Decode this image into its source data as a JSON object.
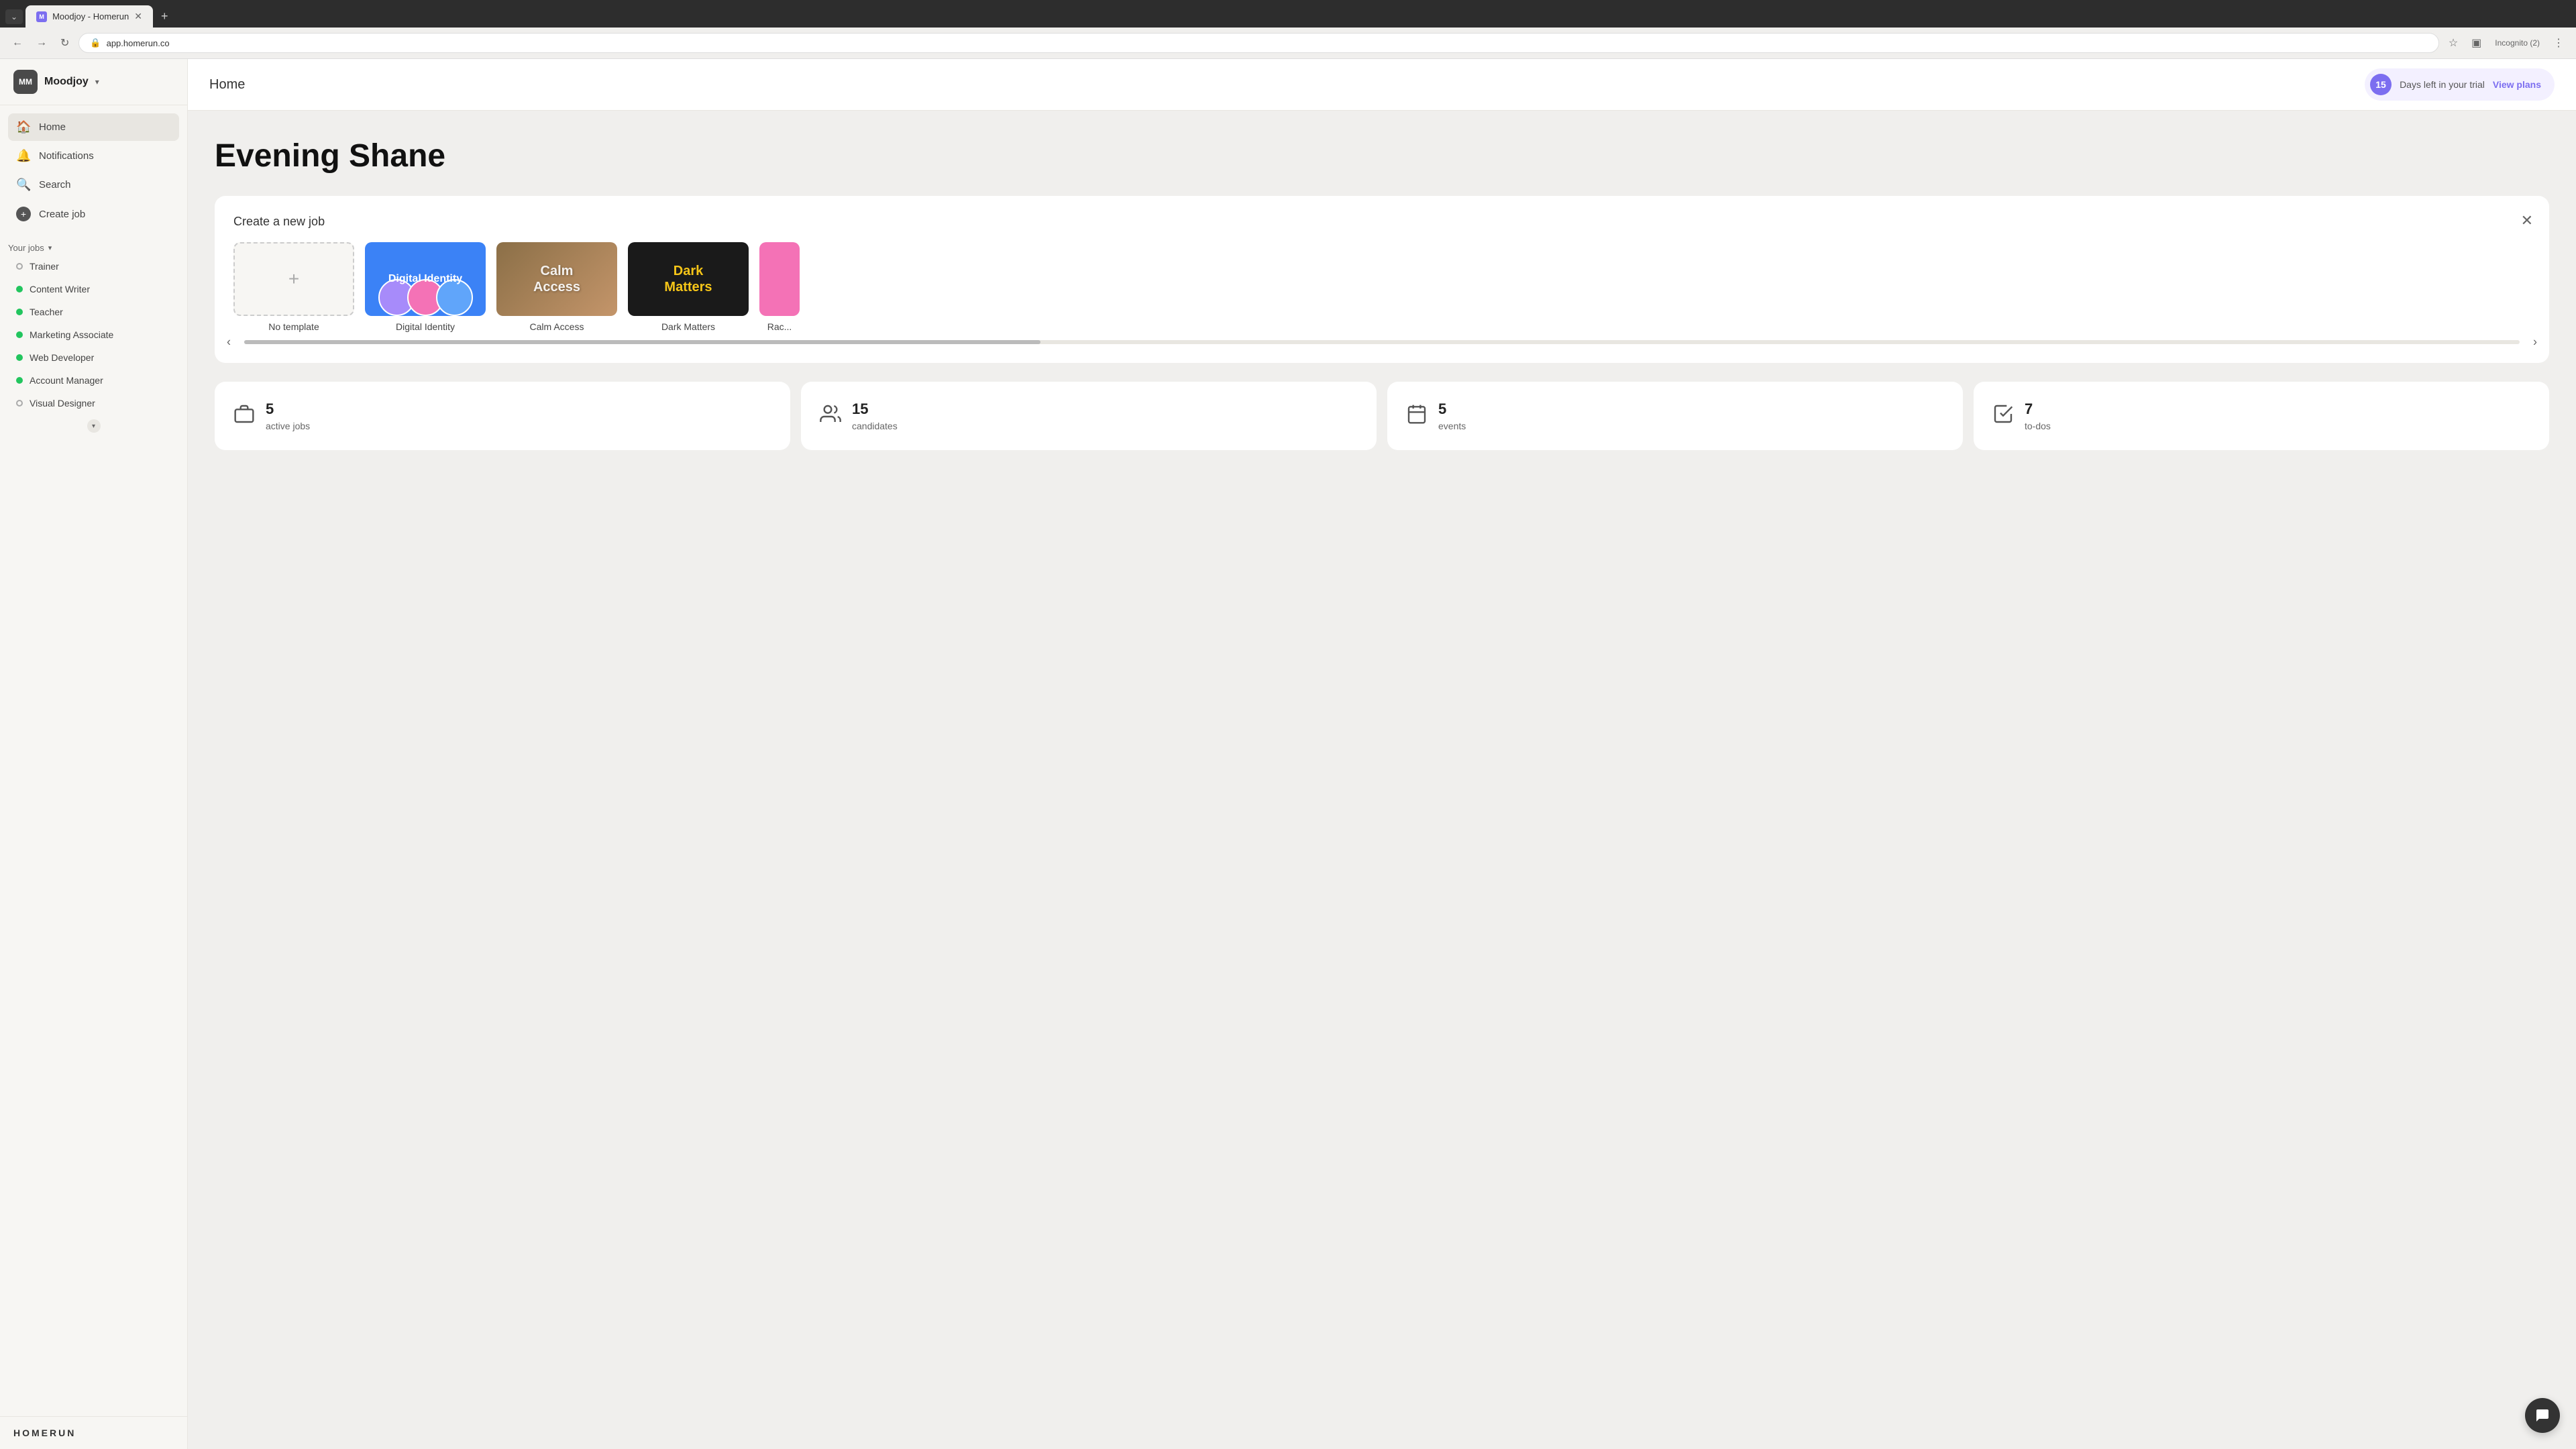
{
  "browser": {
    "tab_favicon": "M",
    "tab_title": "Moodjoy - Homerun",
    "url": "app.homerun.co",
    "incognito_label": "Incognito (2)"
  },
  "sidebar": {
    "avatar_initials": "MM",
    "company_name": "Moodjoy",
    "nav_items": [
      {
        "id": "home",
        "label": "Home",
        "icon": "🏠",
        "active": true
      },
      {
        "id": "notifications",
        "label": "Notifications",
        "icon": "🔔",
        "active": false
      },
      {
        "id": "search",
        "label": "Search",
        "icon": "🔍",
        "active": false
      },
      {
        "id": "create-job",
        "label": "Create job",
        "icon": "+",
        "active": false
      }
    ],
    "your_jobs_label": "Your jobs",
    "jobs": [
      {
        "id": "trainer",
        "label": "Trainer",
        "dot_type": "outline"
      },
      {
        "id": "content-writer",
        "label": "Content Writer",
        "dot_type": "green"
      },
      {
        "id": "teacher",
        "label": "Teacher",
        "dot_type": "green"
      },
      {
        "id": "marketing-associate",
        "label": "Marketing Associate",
        "dot_type": "green"
      },
      {
        "id": "web-developer",
        "label": "Web Developer",
        "dot_type": "green"
      },
      {
        "id": "account-manager",
        "label": "Account Manager",
        "dot_type": "green"
      },
      {
        "id": "visual-designer",
        "label": "Visual Designer",
        "dot_type": "outline"
      }
    ],
    "logo_text": "HOMERUN"
  },
  "topbar": {
    "page_title": "Home",
    "trial_number": "15",
    "trial_text": "Days left in your trial",
    "view_plans_label": "View plans"
  },
  "main": {
    "greeting": "Evening Shane",
    "create_job_section": {
      "title": "Create a new job",
      "templates": [
        {
          "id": "no-template",
          "label": "No template",
          "type": "blank"
        },
        {
          "id": "digital-identity",
          "label": "Digital Identity",
          "type": "digital-identity"
        },
        {
          "id": "calm-access",
          "label": "Calm Access",
          "type": "calm-access",
          "line1": "Calm",
          "line2": "Access"
        },
        {
          "id": "dark-matters",
          "label": "Dark Matters",
          "type": "dark-matters",
          "line1": "Dark",
          "line2": "Matters"
        },
        {
          "id": "rac",
          "label": "Rac...",
          "type": "rac"
        }
      ]
    },
    "stats": [
      {
        "id": "active-jobs",
        "icon": "▭",
        "number": "5",
        "label": "active jobs"
      },
      {
        "id": "candidates",
        "icon": "👥",
        "number": "15",
        "label": "candidates"
      },
      {
        "id": "events",
        "icon": "📅",
        "number": "5",
        "label": "events"
      },
      {
        "id": "todos",
        "icon": "☑",
        "number": "7",
        "label": "to-dos"
      }
    ]
  }
}
